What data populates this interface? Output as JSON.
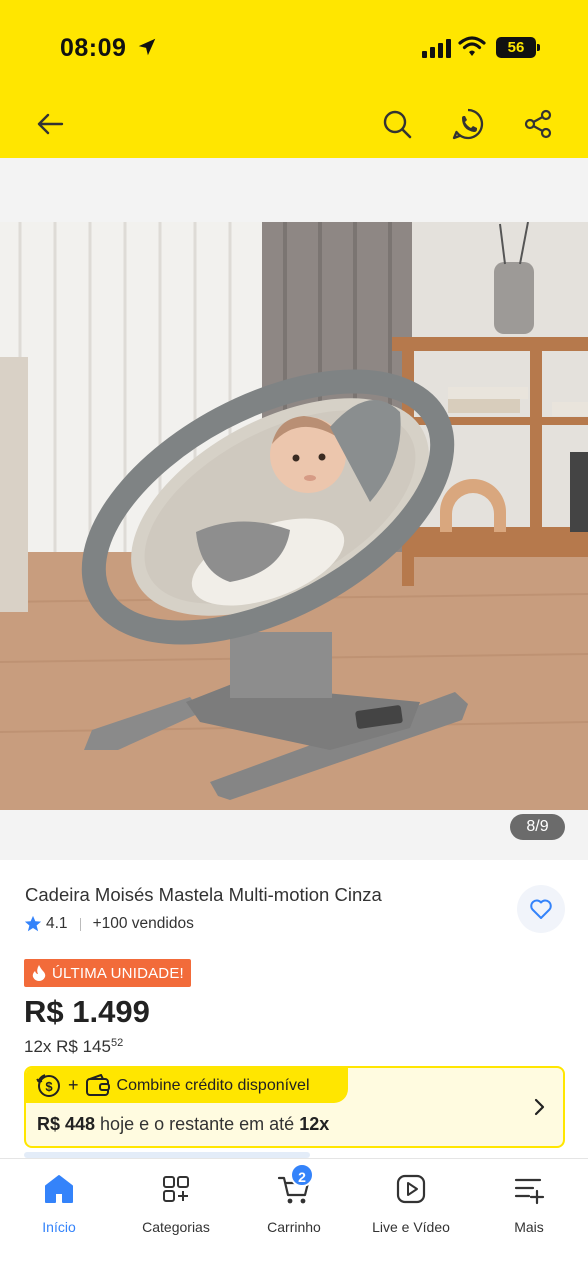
{
  "status_bar": {
    "time": "08:09",
    "battery": "56"
  },
  "header": {
    "back_icon": "arrow-left-icon",
    "search_icon": "search-icon",
    "whatsapp_icon": "whatsapp-icon",
    "share_icon": "share-icon",
    "background_color": "#ffe600"
  },
  "gallery": {
    "counter": "8/9"
  },
  "product": {
    "title": "Cadeira Moisés Mastela Multi-motion Cinza",
    "rating": "4.1",
    "sold": "+100 vendidos",
    "badge": "ÚLTIMA UNIDADE!",
    "price": "R$ 1.499",
    "installments_prefix": "12x R$ 145",
    "installments_cents": "52"
  },
  "credit": {
    "plus": "+",
    "label": "Combine crédito disponível",
    "amount": "R$ 448",
    "text": " hoje e o restante em até ",
    "count": "12x"
  },
  "tabbar": {
    "items": [
      {
        "label": "Início",
        "icon": "home-icon",
        "active": true
      },
      {
        "label": "Categorias",
        "icon": "categories-icon"
      },
      {
        "label": "Carrinho",
        "icon": "cart-icon",
        "badge": "2"
      },
      {
        "label": "Live e Vídeo",
        "icon": "play-icon"
      },
      {
        "label": "Mais",
        "icon": "menu-plus-icon"
      }
    ]
  },
  "colors": {
    "accent": "#3483fa",
    "badge": "#f26b3a",
    "yellow": "#ffe600"
  }
}
